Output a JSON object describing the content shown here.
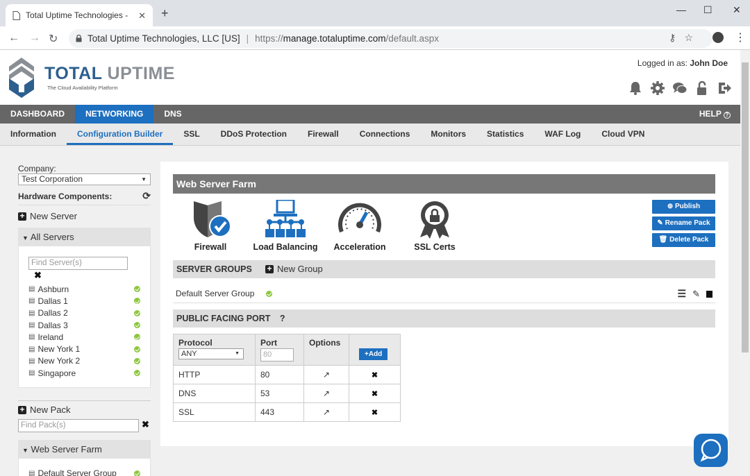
{
  "browser": {
    "tab_title": "Total Uptime Technologies - Clou",
    "omnibox_org": "Total Uptime Technologies, LLC [US]",
    "omnibox_url_prefix": "https://",
    "omnibox_url_domain": "manage.totaluptime.com",
    "omnibox_url_path": "/default.aspx"
  },
  "header": {
    "brand": "TOTAL",
    "brand_2": "UPTIME",
    "tagline": "The Cloud Availability Platform",
    "logged_label": "Logged in as:",
    "user": "John Doe"
  },
  "mainnav": {
    "items": [
      "DASHBOARD",
      "NETWORKING",
      "DNS"
    ],
    "active": "NETWORKING",
    "help": "HELP"
  },
  "subnav": {
    "items": [
      "Information",
      "Configuration Builder",
      "SSL",
      "DDoS Protection",
      "Firewall",
      "Connections",
      "Monitors",
      "Statistics",
      "WAF Log",
      "Cloud VPN"
    ],
    "active": "Configuration Builder"
  },
  "sidebar": {
    "company_label": "Company:",
    "company_value": "Test Corporation",
    "hardware_label": "Hardware Components:",
    "new_server": "New Server",
    "all_servers": "All Servers",
    "find_server_placeholder": "Find Server(s)",
    "servers": [
      "Ashburn",
      "Dallas 1",
      "Dallas 2",
      "Dallas 3",
      "Ireland",
      "New York 1",
      "New York 2",
      "Singapore"
    ],
    "new_pack": "New Pack",
    "find_pack_placeholder": "Find Pack(s)",
    "pack_name": "Web Server Farm",
    "pack_group": "Default Server Group"
  },
  "main": {
    "title": "Web Server Farm",
    "features": [
      "Firewall",
      "Load Balancing",
      "Acceleration",
      "SSL Certs"
    ],
    "publish": "Publish",
    "rename": "Rename Pack",
    "delete": "Delete Pack",
    "server_groups_label": "SERVER GROUPS",
    "new_group": "New Group",
    "default_group": "Default Server Group",
    "public_port_label": "PUBLIC FACING PORT",
    "help_q": "?",
    "col_protocol": "Protocol",
    "col_port": "Port",
    "col_options": "Options",
    "protocol_value": "ANY",
    "port_placeholder": "80",
    "add": "Add",
    "rows": [
      {
        "protocol": "HTTP",
        "port": "80"
      },
      {
        "protocol": "DNS",
        "port": "53"
      },
      {
        "protocol": "SSL",
        "port": "443"
      }
    ]
  },
  "colors": {
    "accent": "#1d6fbf",
    "nav_bg": "#666666",
    "status_ok": "#8dc63f"
  }
}
